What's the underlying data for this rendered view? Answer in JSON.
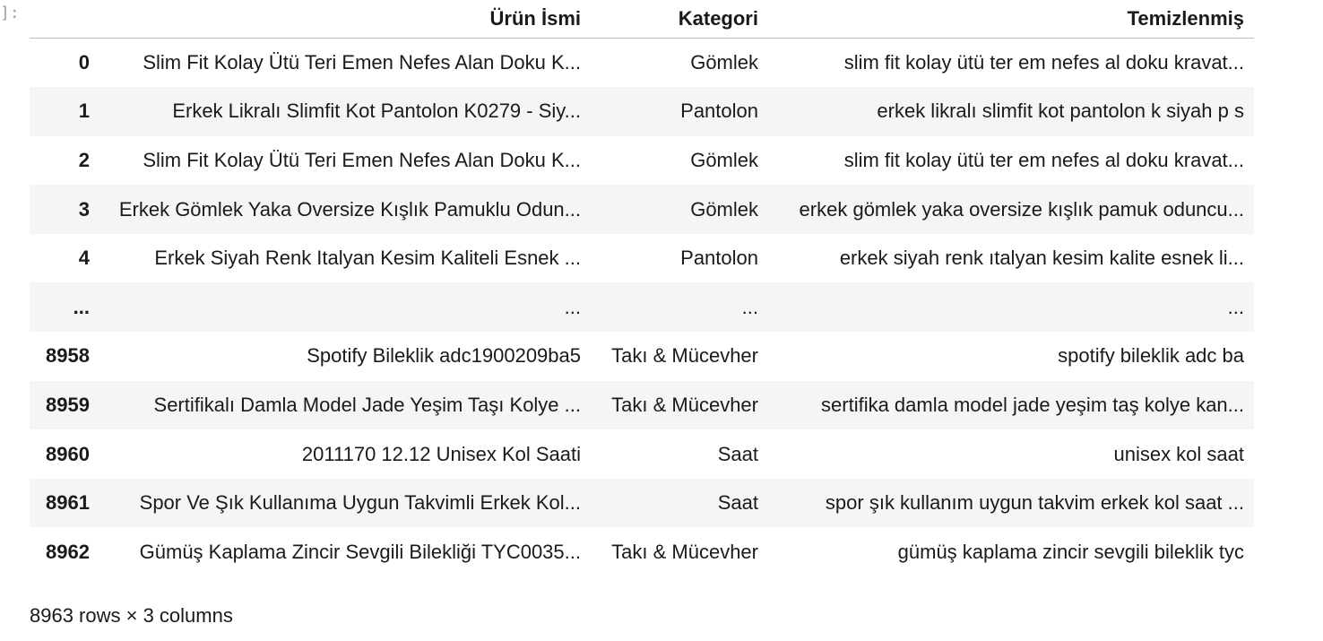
{
  "prompt_marker": "]:",
  "table": {
    "columns": [
      "",
      "Ürün İsmi",
      "Kategori",
      "Temizlenmiş"
    ],
    "rows": [
      {
        "index": "0",
        "name": "Slim Fit Kolay Ütü Teri Emen Nefes Alan Doku K...",
        "category": "Gömlek",
        "cleaned": "slim fit kolay ütü ter em nefes al doku kravat..."
      },
      {
        "index": "1",
        "name": "Erkek Likralı Slimfit Kot Pantolon K0279 - Siy...",
        "category": "Pantolon",
        "cleaned": "erkek likralı slimfit kot pantolon k siyah p s"
      },
      {
        "index": "2",
        "name": "Slim Fit Kolay Ütü Teri Emen Nefes Alan Doku K...",
        "category": "Gömlek",
        "cleaned": "slim fit kolay ütü ter em nefes al doku kravat..."
      },
      {
        "index": "3",
        "name": "Erkek Gömlek Yaka Oversize Kışlık Pamuklu Odun...",
        "category": "Gömlek",
        "cleaned": "erkek gömlek yaka oversize kışlık pamuk oduncu..."
      },
      {
        "index": "4",
        "name": "Erkek Siyah Renk Italyan Kesim Kaliteli Esnek ...",
        "category": "Pantolon",
        "cleaned": "erkek siyah renk ıtalyan kesim kalite esnek li..."
      },
      {
        "index": "...",
        "name": "...",
        "category": "...",
        "cleaned": "..."
      },
      {
        "index": "8958",
        "name": "Spotify Bileklik adc1900209ba5",
        "category": "Takı & Mücevher",
        "cleaned": "spotify bileklik adc ba"
      },
      {
        "index": "8959",
        "name": "Sertifikalı Damla Model Jade Yeşim Taşı Kolye ...",
        "category": "Takı & Mücevher",
        "cleaned": "sertifika damla model jade yeşim taş kolye kan..."
      },
      {
        "index": "8960",
        "name": "2011170 12.12 Unisex Kol Saati",
        "category": "Saat",
        "cleaned": "unisex kol saat"
      },
      {
        "index": "8961",
        "name": "Spor Ve Şık Kullanıma Uygun Takvimli Erkek Kol...",
        "category": "Saat",
        "cleaned": "spor şık kullanım uygun takvim erkek kol saat ..."
      },
      {
        "index": "8962",
        "name": "Gümüş Kaplama Zincir Sevgili Bilekliği TYC0035...",
        "category": "Takı & Mücevher",
        "cleaned": "gümüş kaplama zincir sevgili bileklik tyc"
      }
    ]
  },
  "shape_caption": "8963 rows × 3 columns",
  "colors": {
    "stripe": "#f5f5f5",
    "header_rule": "#bdbdbd",
    "text": "#1a1a1a",
    "prompt": "#9e9e9e"
  }
}
